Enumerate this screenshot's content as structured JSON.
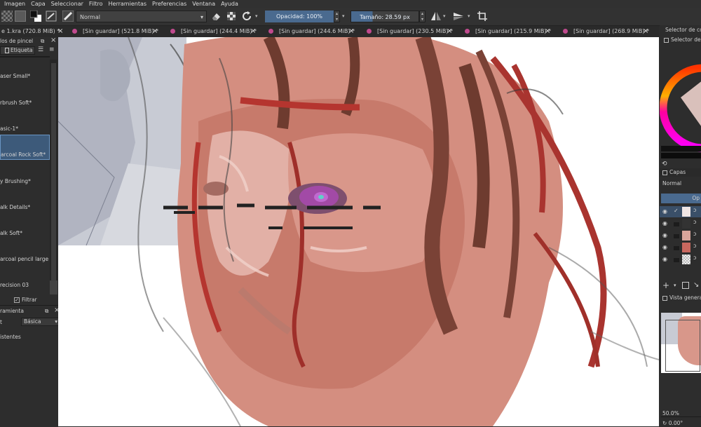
{
  "menu": [
    "Imagen",
    "Capa",
    "Seleccionar",
    "Filtro",
    "Herramientas",
    "Preferencias",
    "Ventana",
    "Ayuda"
  ],
  "toolbar": {
    "blend_mode": "Normal",
    "opacity": "Opacidad: 100%",
    "size": "Tamaño: 28.59 px"
  },
  "tabs": [
    {
      "label": "e 1.kra (720.8 MiB) *"
    },
    {
      "label": "[Sin guardar]  (521.8 MiB) *"
    },
    {
      "label": "[Sin guardar]  (244.4 MiB) *"
    },
    {
      "label": "[Sin guardar]  (244.6 MiB) *"
    },
    {
      "label": "[Sin guardar]  (230.5 MiB) *"
    },
    {
      "label": "[Sin guardar]  (215.9 MiB) *"
    },
    {
      "label": "[Sin guardar]  (268.9 MiB) *"
    }
  ],
  "brush_presets": {
    "title": "los de pincel",
    "tag_label": "Etiqueta",
    "items": [
      {
        "label": "aser Small*"
      },
      {
        "label": "rbrush Soft*"
      },
      {
        "label": "asic-1*"
      },
      {
        "label": "arcoal Rock Soft*",
        "selected": true
      },
      {
        "label": "y Brushing*"
      },
      {
        "label": "alk Details*"
      },
      {
        "label": "alk Soft*"
      },
      {
        "label": "arcoal pencil large twi"
      },
      {
        "label": "recision 03"
      }
    ],
    "filter_label": "Filtrar etiqueta"
  },
  "tool_options": {
    "title": "ramienta",
    "row_label": "t",
    "row_value": "Básica",
    "item": "istentes"
  },
  "right_panel": {
    "color_selector_title": "Selector de colo",
    "color_selector_sub": "Selector de c",
    "layers_title": "Capas",
    "layers_blend": "Normal",
    "layers_opacity": "Op",
    "overview_title": "Vista general",
    "zoom": "50.0%",
    "rotation": "0.00°"
  },
  "colors": {
    "accent": "#4a6a8f",
    "selected_item": "#3d5a7a",
    "tab_icon": "#c04a8e"
  }
}
